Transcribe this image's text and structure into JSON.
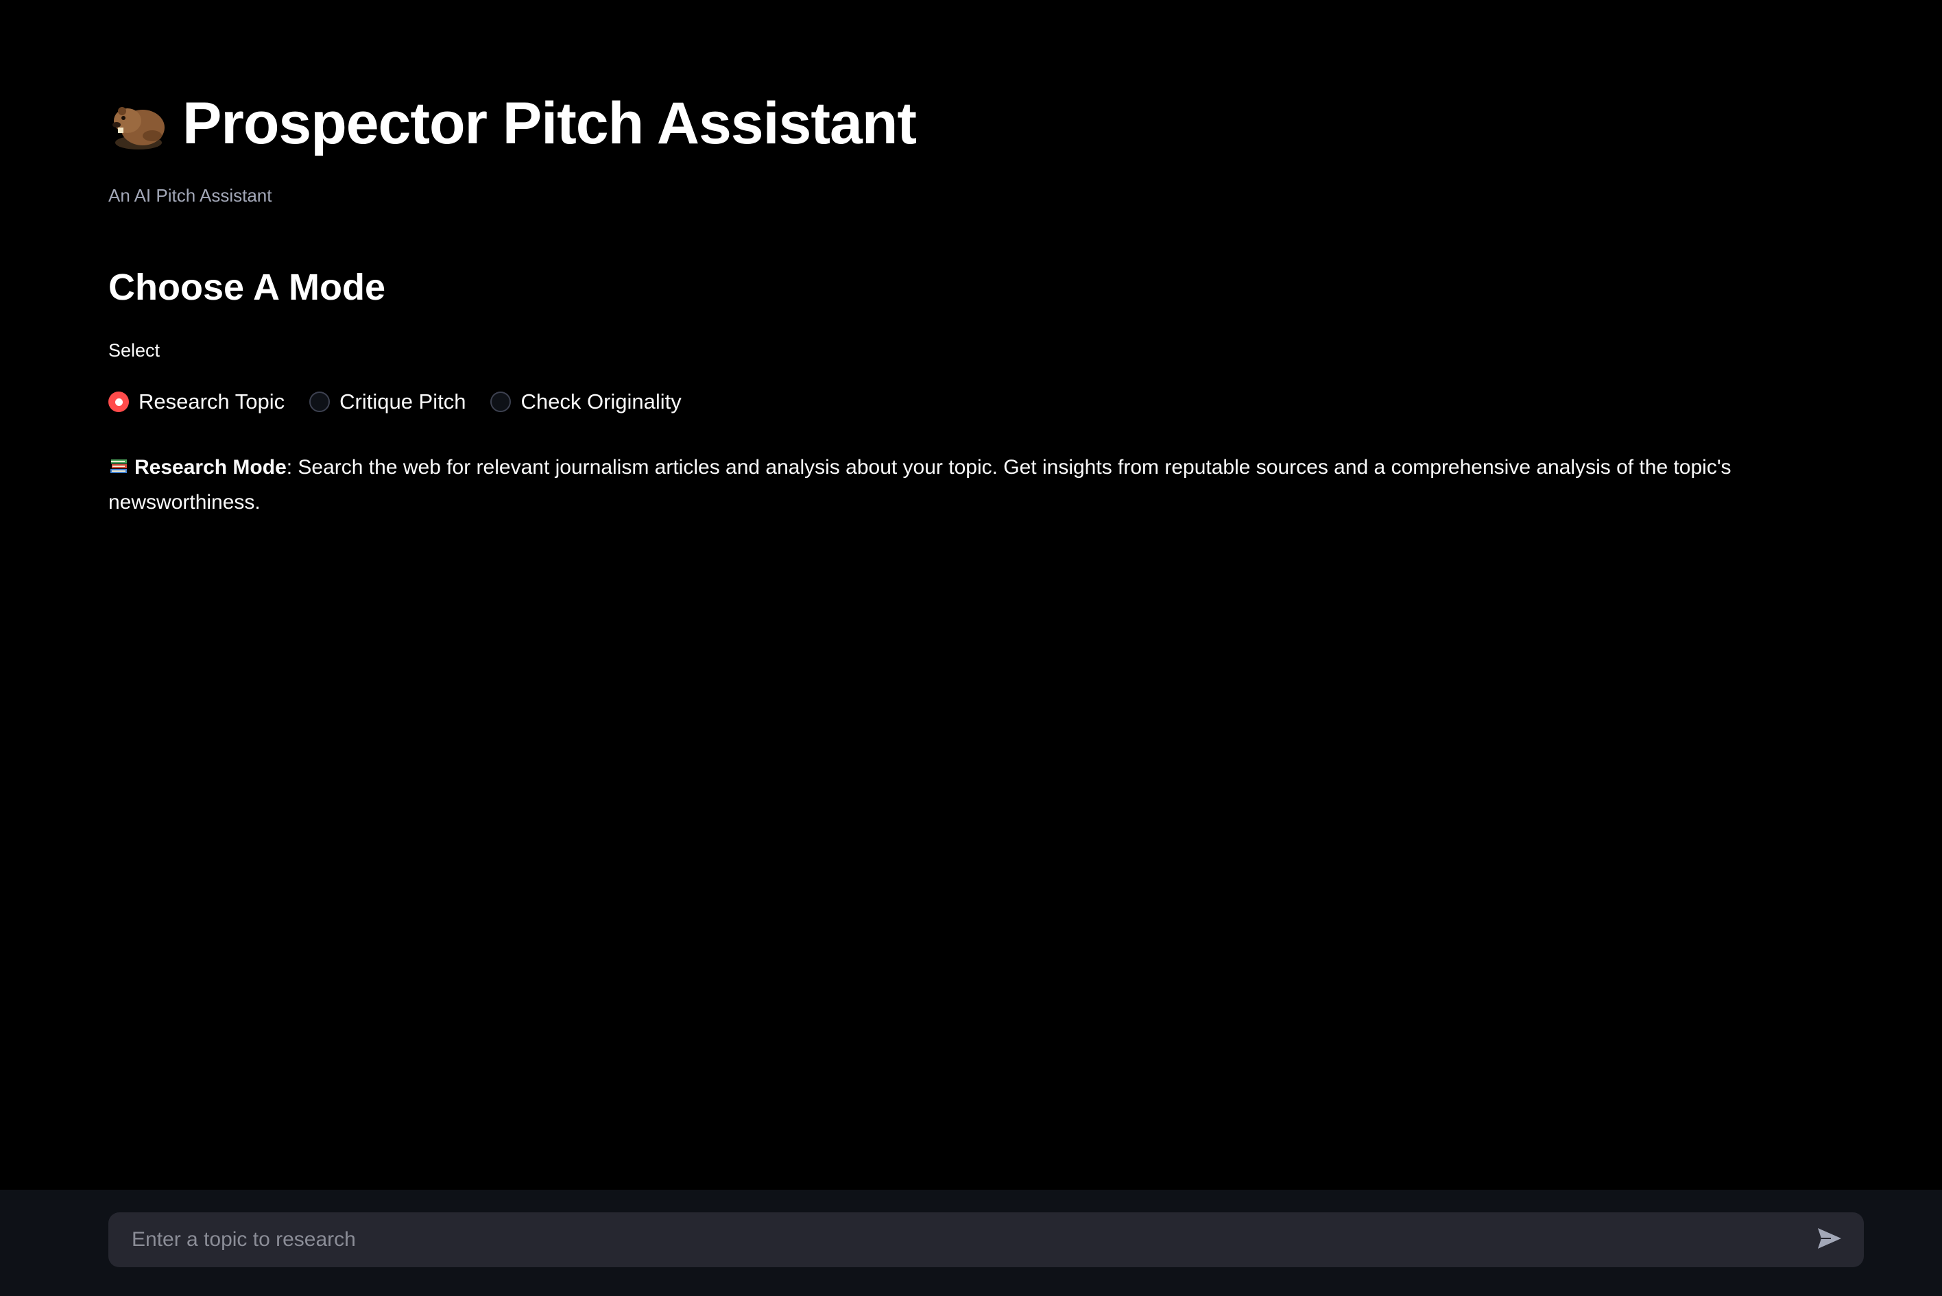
{
  "header": {
    "title": "Prospector Pitch Assistant",
    "subtitle": "An AI Pitch Assistant",
    "title_icon": "beaver-icon"
  },
  "mode_section": {
    "heading": "Choose A Mode",
    "radio_label": "Select",
    "options": [
      {
        "label": "Research Topic",
        "selected": true
      },
      {
        "label": "Critique Pitch",
        "selected": false
      },
      {
        "label": "Check Originality",
        "selected": false
      }
    ],
    "description": {
      "icon": "books-icon",
      "bold": "Research Mode",
      "text": ": Search the web for relevant journalism articles and analysis about your topic. Get insights from reputable sources and a comprehensive analysis of the topic's newsworthiness."
    }
  },
  "chat": {
    "placeholder": "Enter a topic to research",
    "send_icon": "send-icon"
  },
  "colors": {
    "background": "#000000",
    "bottom_bar": "#0e1117",
    "input_bg": "#262730",
    "accent": "#ff4b4b",
    "text": "#fafafa",
    "muted_text": "#a3a8b8"
  }
}
